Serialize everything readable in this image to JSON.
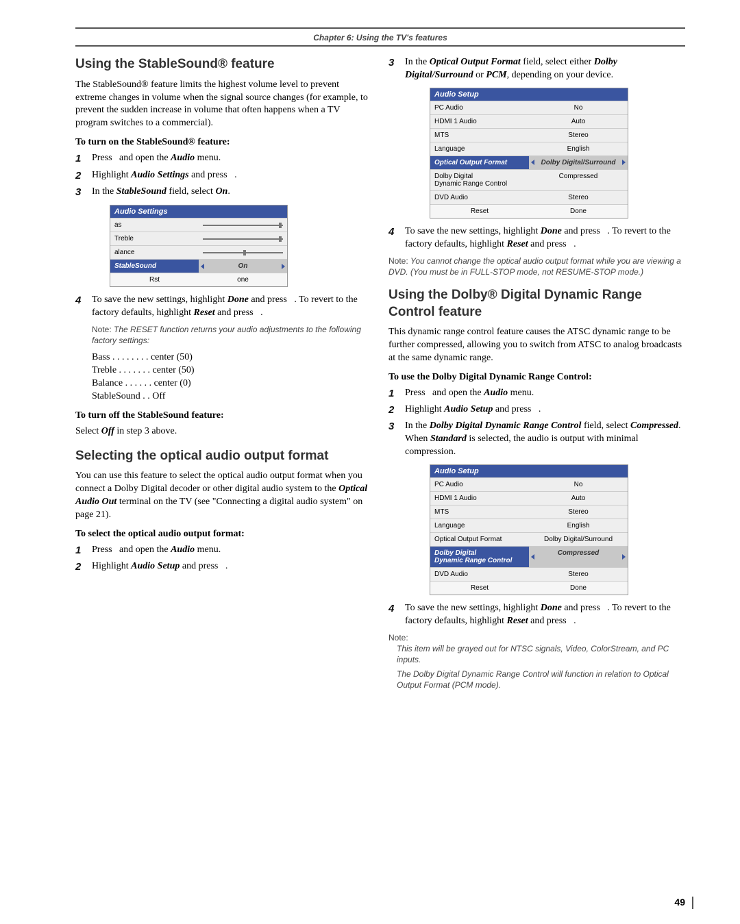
{
  "chapter": "Chapter 6: Using the TV's features",
  "pagenum": "49",
  "left": {
    "h2a": "Using the StableSound® feature",
    "p1": "The StableSound® feature limits the highest volume level to prevent extreme changes in volume when the signal source changes (for example, to prevent the sudden increase in volume that often happens when a TV program switches to a commercial).",
    "sub1": "To turn on the StableSound® feature:",
    "steps1": [
      {
        "n": "1",
        "t": "Press   and open the <b><i>Audio</i></b> menu."
      },
      {
        "n": "2",
        "t": "Highlight <b><i>Audio Settings</i></b> and press   ."
      },
      {
        "n": "3",
        "t": "In the <b><i>StableSound</i></b> field, select <b><i>On</i></b>."
      }
    ],
    "panel1": {
      "title": "Audio Settings",
      "rows": [
        {
          "l": "as",
          "r": ""
        },
        {
          "l": "Treble",
          "r": ""
        },
        {
          "l": "alance",
          "r": ""
        }
      ],
      "hl": {
        "l": "StableSound",
        "r": "On"
      },
      "footer": {
        "l": "Rst",
        "r": "one"
      }
    },
    "step4": {
      "n": "4",
      "t": "To save the new settings, highlight <b><i>Done</i></b> and press   . To revert to the factory defaults, highlight <b><i>Reset</i></b> and press   ."
    },
    "note1": {
      "label": "Note:",
      "body": "The RESET function returns your audio adjustments to the following factory settings:"
    },
    "factory": [
      "Bass  . . . . . . . .  center (50)",
      "Treble  . . . . . . .  center (50)",
      "Balance  . . . . . .  center (0)",
      "StableSound  . .  Off"
    ],
    "sub2": "To turn off the StableSound feature:",
    "p2": "Select <b><i>Off</i></b> in step 3 above.",
    "h2b": "Selecting the optical audio output format",
    "p3": "You can use this feature to select the optical audio output format when you connect a Dolby Digital decoder or other digital audio system to the <b><i>Optical Audio Out</i></b> terminal on the TV (see \"Connecting a digital audio system\" on page 21).",
    "sub3": "To select the optical audio output format:",
    "steps3": [
      {
        "n": "1",
        "t": "Press   and open the <b><i>Audio</i></b> menu."
      },
      {
        "n": "2",
        "t": "Highlight <b><i>Audio Setup</i></b> and press   ."
      }
    ]
  },
  "right": {
    "step3": {
      "n": "3",
      "t": "In the <b><i>Optical Output Format</i></b> field, select either <b><i>Dolby Digital/Surround</i></b> or <b><i>PCM</i></b>, depending on your device."
    },
    "panel2": {
      "title": "Audio Setup",
      "rows": [
        {
          "l": "PC Audio",
          "r": "No"
        },
        {
          "l": "HDMI 1 Audio",
          "r": "Auto"
        },
        {
          "l": "MTS",
          "r": "Stereo"
        },
        {
          "l": "Language",
          "r": "English"
        }
      ],
      "hl": {
        "l": "Optical Output Format",
        "r": "Dolby Digital/Surround"
      },
      "rows2": [
        {
          "l": "Dolby Digital\nDynamic Range Control",
          "r": "Compressed"
        },
        {
          "l": "DVD Audio",
          "r": "Stereo"
        }
      ],
      "footer": {
        "l": "Reset",
        "r": "Done"
      }
    },
    "step4": {
      "n": "4",
      "t": "To save the new settings, highlight <b><i>Done</i></b> and press   . To revert to the factory defaults, highlight <b><i>Reset</i></b> and press   ."
    },
    "note2": {
      "label": "Note:",
      "body": "You cannot change the optical audio output format while you are viewing a DVD. (You must be in FULL-STOP mode, not RESUME-STOP mode.)"
    },
    "h2c": "Using the Dolby® Digital Dynamic Range Control feature",
    "p4": "This dynamic range control feature causes the ATSC dynamic range to be further compressed, allowing you to switch from ATSC to analog broadcasts at the same dynamic range.",
    "sub4": "To use the Dolby Digital Dynamic Range Control:",
    "steps4": [
      {
        "n": "1",
        "t": "Press   and open the <b><i>Audio</i></b> menu."
      },
      {
        "n": "2",
        "t": "Highlight <b><i>Audio Setup</i></b> and press   ."
      },
      {
        "n": "3",
        "t": "In the <b><i>Dolby Digital Dynamic Range Control</i></b> field, select <b><i>Compressed</i></b>. When <b><i>Standard</i></b> is selected, the audio is output with minimal compression."
      }
    ],
    "panel3": {
      "title": "Audio Setup",
      "rows": [
        {
          "l": "PC Audio",
          "r": "No"
        },
        {
          "l": "HDMI 1 Audio",
          "r": "Auto"
        },
        {
          "l": "MTS",
          "r": "Stereo"
        },
        {
          "l": "Language",
          "r": "English"
        },
        {
          "l": "Optical Output Format",
          "r": "Dolby Digital/Surround"
        }
      ],
      "hl": {
        "l": "Dolby Digital\nDynamic Range Control",
        "r": "Compressed"
      },
      "rows2": [
        {
          "l": "DVD Audio",
          "r": "Stereo"
        }
      ],
      "footer": {
        "l": "Reset",
        "r": "Done"
      }
    },
    "step4b": {
      "n": "4",
      "t": "To save the new settings, highlight <b><i>Done</i></b> and press   . To revert to the factory defaults, highlight <b><i>Reset</i></b> and press   ."
    },
    "note3": {
      "label": "Note:",
      "body1": "This item will be grayed out for NTSC signals, Video, ColorStream, and PC inputs.",
      "body2": "The Dolby Digital Dynamic Range Control will function in relation to Optical Output Format (PCM mode)."
    }
  }
}
